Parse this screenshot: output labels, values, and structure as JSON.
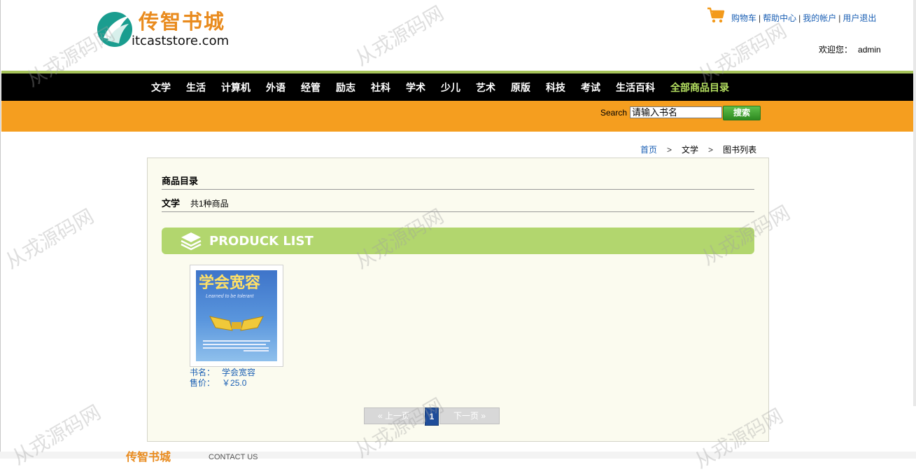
{
  "header": {
    "logo_cn": "传智书城",
    "logo_en": "itcaststore.com",
    "top_links": [
      "购物车",
      "帮助中心",
      "我的帐户",
      "用户退出"
    ],
    "welcome_label": "欢迎您：",
    "username": "admin"
  },
  "nav": {
    "items": [
      "文学",
      "生活",
      "计算机",
      "外语",
      "经管",
      "励志",
      "社科",
      "学术",
      "少儿",
      "艺术",
      "原版",
      "科技",
      "考试",
      "生活百科"
    ],
    "all_label": "全部商品目录"
  },
  "search": {
    "label": "Search",
    "value": "请输入书名",
    "button": "搜索"
  },
  "breadcrumb": {
    "home": "首页",
    "sep": ">",
    "category": "文学",
    "current": "图书列表"
  },
  "main": {
    "catalog_title": "商品目录",
    "category": "文学",
    "count": "共1种商品",
    "banner_text": "PRODUCK LIST"
  },
  "book": {
    "cover_title": "学会宽容",
    "cover_subtitle": "Learned to be tolerant",
    "name_label": "书名：",
    "name": "学会宽容",
    "price_label": "售价：",
    "price": "￥25.0"
  },
  "pager": {
    "prev": "上一页",
    "current": "1",
    "next": "下一页"
  },
  "footer": {
    "logo": "传智书城",
    "contact": "CONTACT US"
  },
  "watermark": "从戎源码网",
  "colors": {
    "nav_bg": "#000000",
    "nav_highlight": "#b5e061",
    "search_bar": "#f59e1f",
    "link": "#1a5fb4",
    "banner": "#b2d66e",
    "panel_bg": "#fbfbef",
    "pager_current": "#1f4d9a",
    "logo": "#e98b1e"
  },
  "icons": [
    "logo-mark-icon",
    "cart-icon",
    "layers-icon"
  ]
}
